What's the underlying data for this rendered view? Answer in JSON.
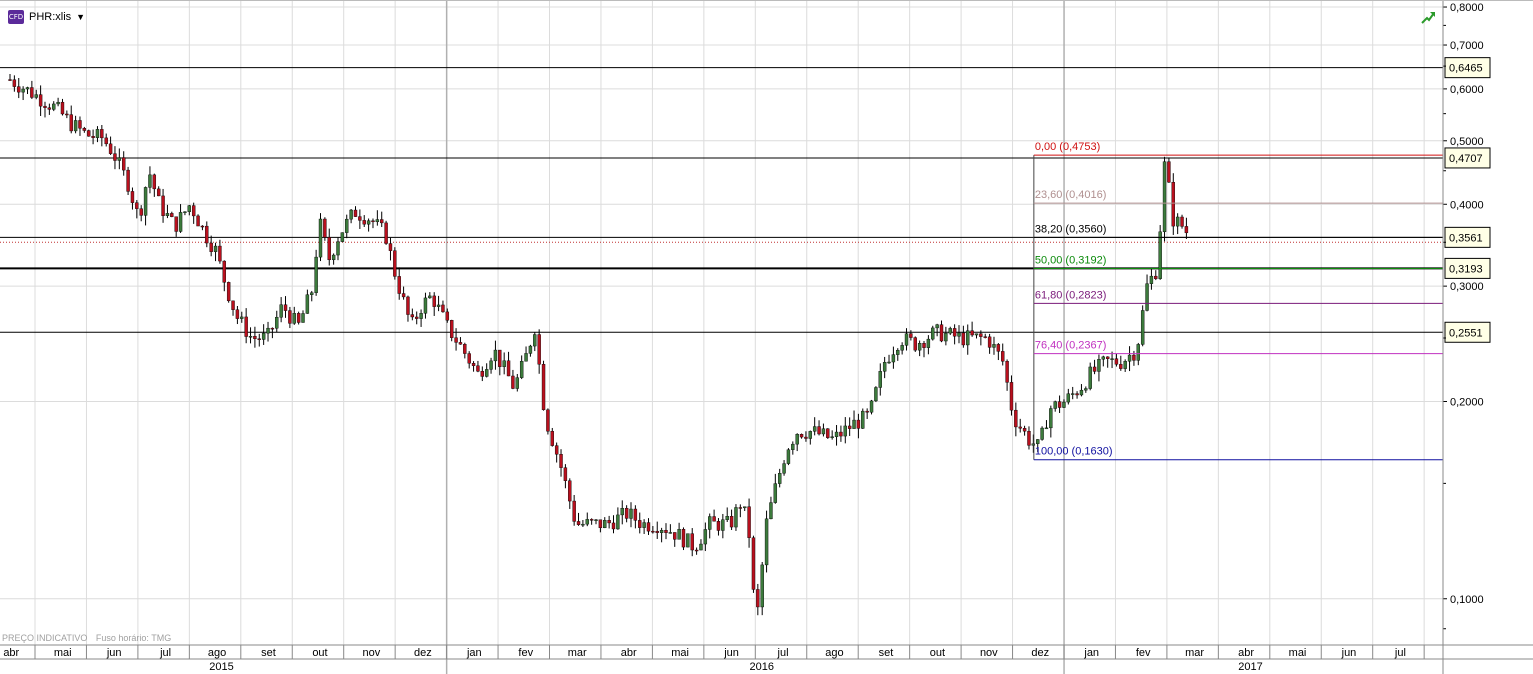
{
  "header": {
    "symbol": "PHR:xlis",
    "badge": "CFD"
  },
  "footer": {
    "note1": "PREÇO INDICATIVO",
    "note2": "Fuso horário: TMG"
  },
  "colors": {
    "up": "#3c7a3c",
    "down": "#b8101e",
    "grid": "#dcdcdc",
    "hline": "#000000",
    "fib0": "#d01010",
    "fib236": "#b09090",
    "fib382": "#000000",
    "fib50": "#0a8a0a",
    "fib618": "#7a1a7a",
    "fib764": "#c030c0",
    "fib100": "#1010a0"
  },
  "chart_data": {
    "type": "candlestick",
    "title": "",
    "y_scale": "log",
    "ylim": [
      0.085,
      0.82
    ],
    "y_ticks": [
      {
        "v": 0.8,
        "label": "0,8000"
      },
      {
        "v": 0.7,
        "label": "0,7000"
      },
      {
        "v": 0.6,
        "label": "0,6000"
      },
      {
        "v": 0.5,
        "label": "0,5000"
      },
      {
        "v": 0.4,
        "label": "0,4000"
      },
      {
        "v": 0.3,
        "label": "0,3000"
      },
      {
        "v": 0.2,
        "label": "0,2000"
      },
      {
        "v": 0.1,
        "label": "0,1000"
      }
    ],
    "x_months": [
      "abr",
      "mai",
      "jun",
      "jul",
      "ago",
      "set",
      "out",
      "nov",
      "dez",
      "jan",
      "fev",
      "mar",
      "abr",
      "mai",
      "jun",
      "jul",
      "ago",
      "set",
      "out",
      "nov",
      "dez",
      "jan",
      "fev",
      "mar",
      "abr",
      "mai",
      "jun",
      "jul"
    ],
    "x_years": [
      {
        "label": "2015",
        "from": 0,
        "to": 9
      },
      {
        "label": "2016",
        "from": 9,
        "to": 21
      },
      {
        "label": "2017",
        "from": 21,
        "to": 28
      }
    ],
    "horizontal_lines": [
      {
        "value": 0.6465,
        "label": "0,6465",
        "style": "solid"
      },
      {
        "value": 0.4707,
        "label": "0,4707",
        "style": "solid"
      },
      {
        "value": 0.3561,
        "label": "0,3561",
        "style": "solid"
      },
      {
        "value": 0.3193,
        "label": "0,3193",
        "style": "bold"
      },
      {
        "value": 0.2551,
        "label": "0,2551",
        "style": "solid"
      },
      {
        "value": 0.35,
        "label": "",
        "style": "dotted-red"
      }
    ],
    "fibonacci": {
      "start_month_index": 19.9,
      "levels": [
        {
          "label": "0,00 (0,4753)",
          "value": 0.4753,
          "key": "fib0"
        },
        {
          "label": "23,60 (0,4016)",
          "value": 0.4016,
          "key": "fib236"
        },
        {
          "label": "38,20 (0,3560)",
          "value": 0.356,
          "key": "fib382"
        },
        {
          "label": "50,00 (0,3192)",
          "value": 0.3192,
          "key": "fib50"
        },
        {
          "label": "61,80 (0,2823)",
          "value": 0.2823,
          "key": "fib618"
        },
        {
          "label": "76,40 (0,2367)",
          "value": 0.2367,
          "key": "fib764"
        },
        {
          "label": "100,00 (0,1630)",
          "value": 0.163,
          "key": "fib100"
        }
      ]
    },
    "price_path": [
      [
        0.0,
        0.62
      ],
      [
        0.3,
        0.6
      ],
      [
        0.6,
        0.58
      ],
      [
        0.9,
        0.56
      ],
      [
        1.2,
        0.53
      ],
      [
        1.5,
        0.51
      ],
      [
        1.8,
        0.505
      ],
      [
        2.0,
        0.48
      ],
      [
        2.3,
        0.43
      ],
      [
        2.5,
        0.38
      ],
      [
        2.7,
        0.45
      ],
      [
        2.9,
        0.4
      ],
      [
        3.2,
        0.37
      ],
      [
        3.5,
        0.4
      ],
      [
        3.8,
        0.36
      ],
      [
        4.0,
        0.34
      ],
      [
        4.2,
        0.3
      ],
      [
        4.4,
        0.27
      ],
      [
        4.7,
        0.25
      ],
      [
        5.0,
        0.25
      ],
      [
        5.3,
        0.28
      ],
      [
        5.6,
        0.26
      ],
      [
        5.9,
        0.3
      ],
      [
        6.0,
        0.38
      ],
      [
        6.2,
        0.33
      ],
      [
        6.4,
        0.36
      ],
      [
        6.7,
        0.39
      ],
      [
        7.0,
        0.38
      ],
      [
        7.3,
        0.36
      ],
      [
        7.5,
        0.31
      ],
      [
        7.8,
        0.26
      ],
      [
        8.0,
        0.28
      ],
      [
        8.2,
        0.29
      ],
      [
        8.5,
        0.26
      ],
      [
        8.8,
        0.24
      ],
      [
        9.1,
        0.22
      ],
      [
        9.4,
        0.24
      ],
      [
        9.8,
        0.21
      ],
      [
        10.0,
        0.23
      ],
      [
        10.2,
        0.26
      ],
      [
        10.4,
        0.19
      ],
      [
        10.7,
        0.16
      ],
      [
        11.0,
        0.13
      ],
      [
        11.3,
        0.13
      ],
      [
        11.6,
        0.13
      ],
      [
        12.0,
        0.135
      ],
      [
        12.3,
        0.13
      ],
      [
        12.6,
        0.13
      ],
      [
        13.0,
        0.125
      ],
      [
        13.3,
        0.12
      ],
      [
        13.6,
        0.13
      ],
      [
        14.0,
        0.13
      ],
      [
        14.2,
        0.14
      ],
      [
        14.35,
        0.13
      ],
      [
        14.5,
        0.09
      ],
      [
        14.7,
        0.13
      ],
      [
        14.9,
        0.15
      ],
      [
        15.1,
        0.17
      ],
      [
        15.3,
        0.18
      ],
      [
        15.6,
        0.18
      ],
      [
        16.0,
        0.175
      ],
      [
        16.4,
        0.185
      ],
      [
        16.7,
        0.19
      ],
      [
        17.0,
        0.23
      ],
      [
        17.3,
        0.25
      ],
      [
        17.6,
        0.245
      ],
      [
        18.0,
        0.255
      ],
      [
        18.5,
        0.25
      ],
      [
        19.0,
        0.25
      ],
      [
        19.3,
        0.23
      ],
      [
        19.5,
        0.19
      ],
      [
        19.8,
        0.175
      ],
      [
        20.0,
        0.17
      ],
      [
        20.2,
        0.195
      ],
      [
        20.5,
        0.2
      ],
      [
        20.8,
        0.21
      ],
      [
        21.0,
        0.22
      ],
      [
        21.3,
        0.23
      ],
      [
        21.6,
        0.23
      ],
      [
        21.9,
        0.24
      ],
      [
        22.1,
        0.3
      ],
      [
        22.3,
        0.32
      ],
      [
        22.45,
        0.47
      ],
      [
        22.6,
        0.38
      ],
      [
        22.8,
        0.37
      ],
      [
        22.95,
        0.355
      ]
    ]
  }
}
